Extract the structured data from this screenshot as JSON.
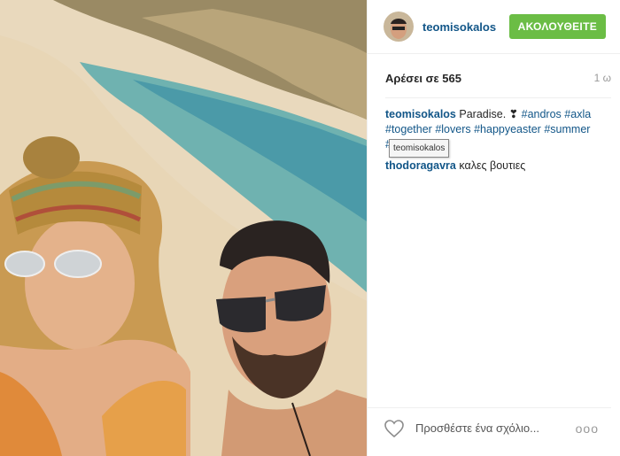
{
  "post": {
    "username": "teomisokalos",
    "follow_label": "ΑΚΟΛΟΥΘΕΙΤΕ",
    "likes_label": "Αρέσει σε 565",
    "age": "1 ω",
    "caption_text": "Paradise. ❣",
    "hashtags": [
      "#andros",
      "#axla",
      "#together",
      "#lovers",
      "#happyeaster",
      "#summer",
      "#"
    ],
    "tooltip": "teomisokalos"
  },
  "comments": [
    {
      "user": "thodoragavra",
      "text": "καλες βουτιες"
    }
  ],
  "footer": {
    "add_comment_placeholder": "Προσθέστε ένα σχόλιο...",
    "more_label": "ooo"
  },
  "icons": {
    "like": "heart-outline-icon",
    "more": "more-options-icon"
  },
  "colors": {
    "follow_button": "#6bbd45",
    "link": "#125688"
  }
}
